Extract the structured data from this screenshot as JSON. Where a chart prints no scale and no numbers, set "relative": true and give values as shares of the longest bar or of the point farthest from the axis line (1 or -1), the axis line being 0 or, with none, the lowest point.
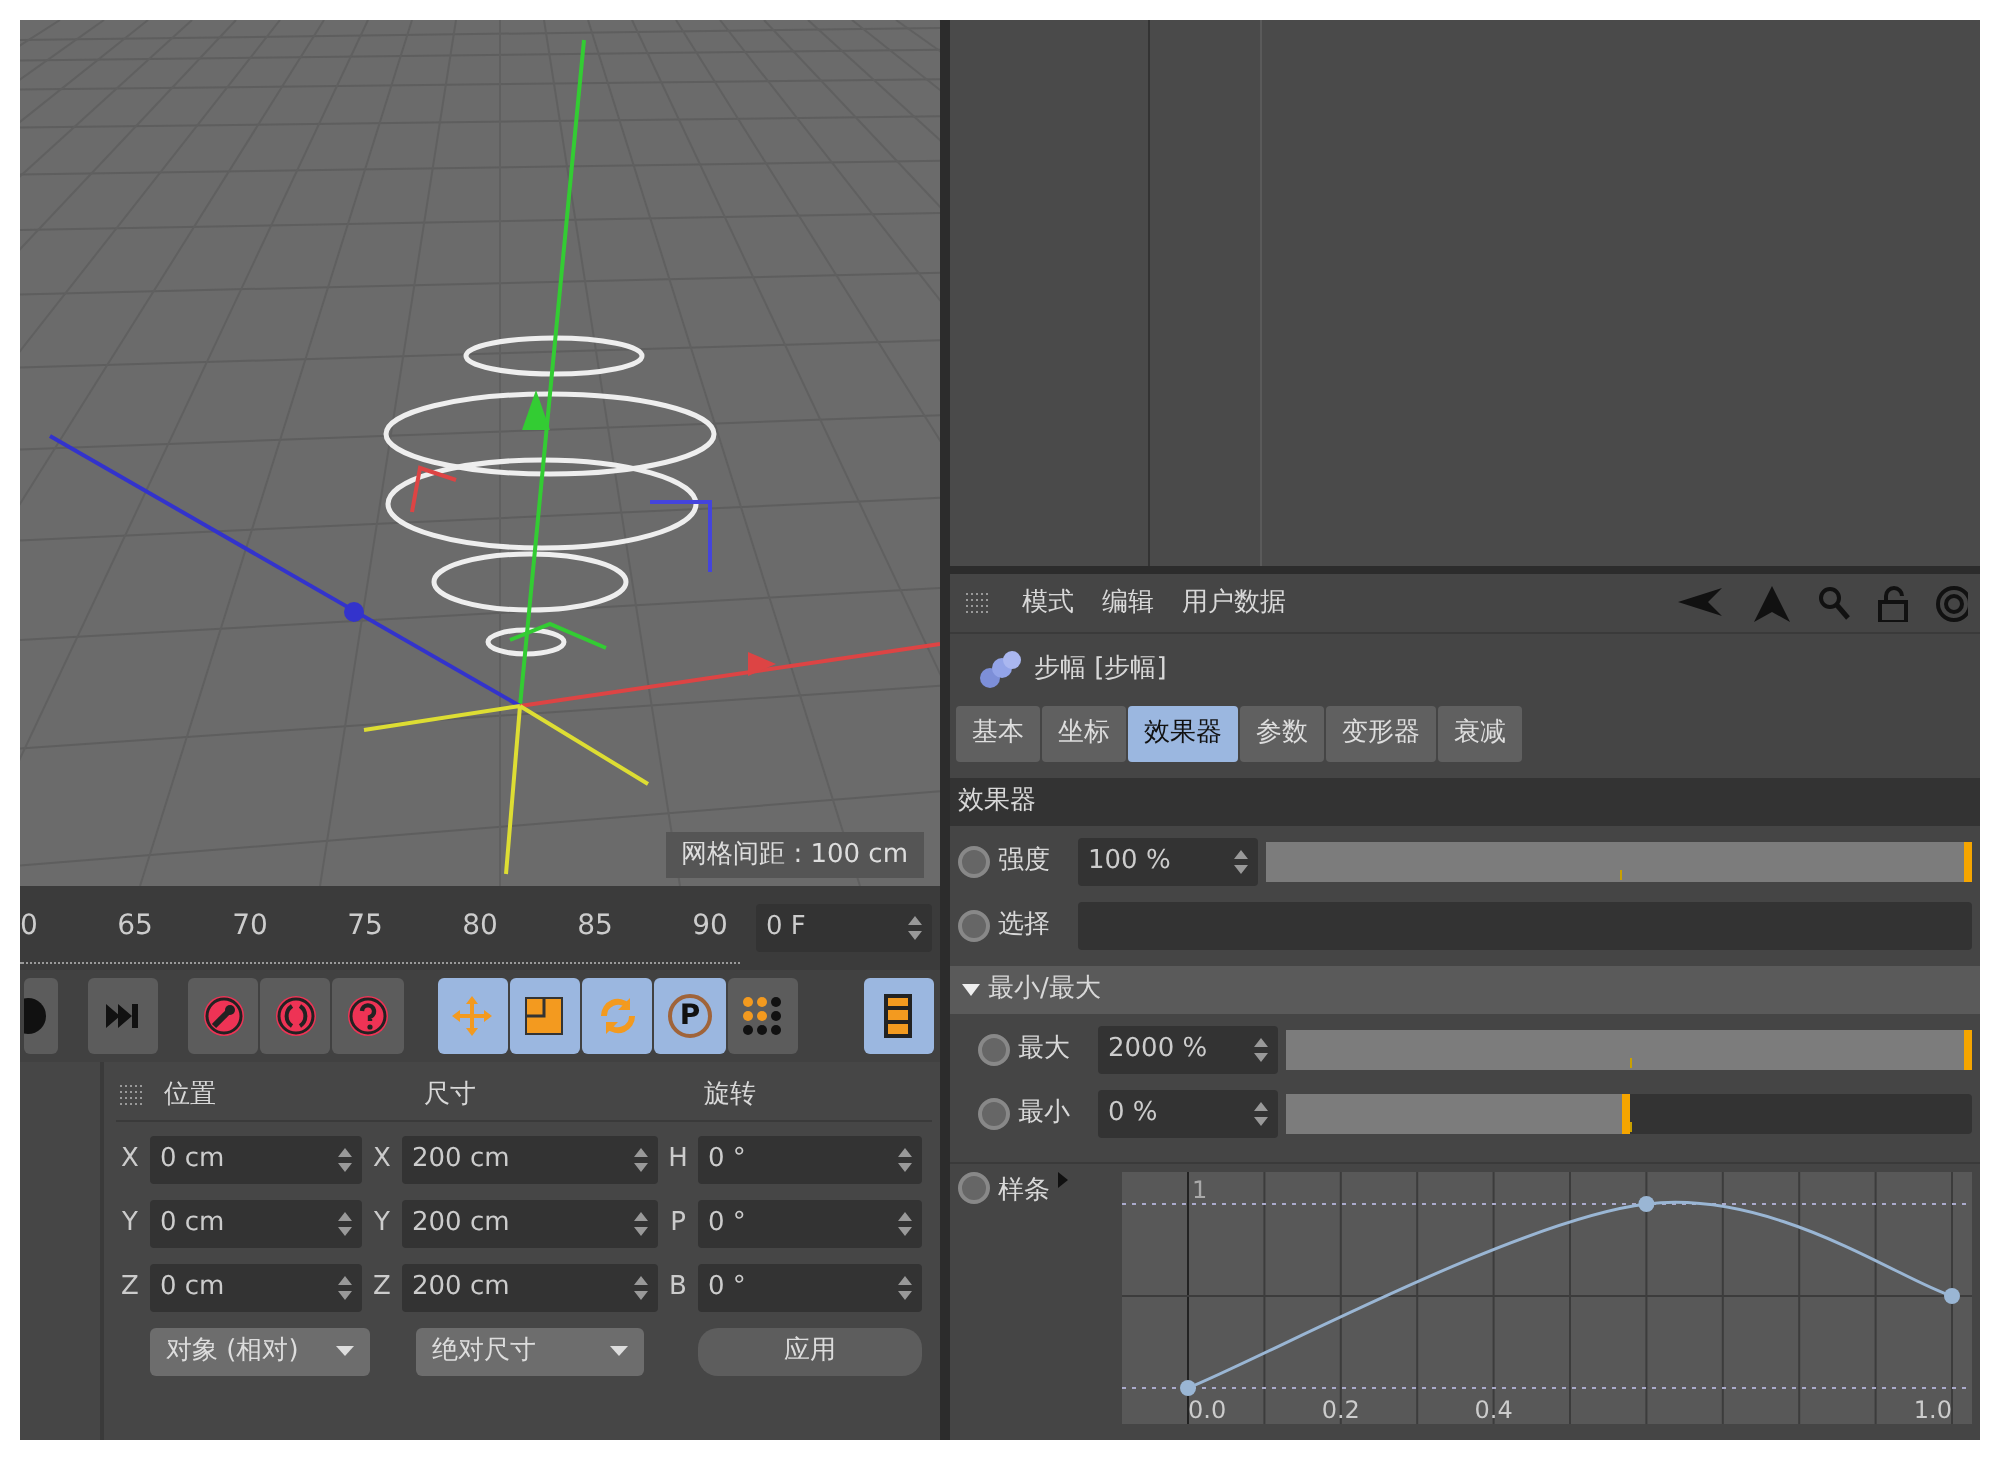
{
  "viewport": {
    "grid_spacing": "网格间距 : 100 cm"
  },
  "timeline": {
    "ticks": [
      "0",
      "65",
      "70",
      "75",
      "80",
      "85",
      "90"
    ],
    "frame_field": "0 F"
  },
  "toolbar": [
    {
      "kind": "play",
      "selected": false
    },
    {
      "kind": "end",
      "selected": false
    },
    {
      "kind": "record",
      "selected": false
    },
    {
      "kind": "autokey",
      "selected": false
    },
    {
      "kind": "help",
      "selected": false
    },
    {
      "kind": "move",
      "selected": true
    },
    {
      "kind": "scale",
      "selected": true
    },
    {
      "kind": "rotate",
      "selected": true
    },
    {
      "kind": "point",
      "label": "P",
      "selected": true
    },
    {
      "kind": "dots",
      "selected": false
    },
    {
      "kind": "film",
      "selected": true
    }
  ],
  "coordinates": {
    "headers": [
      "位置",
      "尺寸",
      "旋转"
    ],
    "rows": [
      {
        "pos_label": "X",
        "pos": "0 cm",
        "size_label": "X",
        "size": "200 cm",
        "rot_label": "H",
        "rot": "0 °"
      },
      {
        "pos_label": "Y",
        "pos": "0 cm",
        "size_label": "Y",
        "size": "200 cm",
        "rot_label": "P",
        "rot": "0 °"
      },
      {
        "pos_label": "Z",
        "pos": "0 cm",
        "size_label": "Z",
        "size": "200 cm",
        "rot_label": "B",
        "rot": "0 °"
      }
    ],
    "dropdowns": [
      "对象 (相对)",
      "绝对尺寸"
    ],
    "apply": "应用"
  },
  "attributes": {
    "menu": [
      "模式",
      "编辑",
      "用户数据"
    ],
    "object": "步幅 [步幅]",
    "tabs": [
      {
        "label": "基本",
        "selected": false
      },
      {
        "label": "坐标",
        "selected": false
      },
      {
        "label": "效果器",
        "selected": true
      },
      {
        "label": "参数",
        "selected": false
      },
      {
        "label": "变形器",
        "selected": false
      },
      {
        "label": "衰减",
        "selected": false
      }
    ],
    "section": "效果器",
    "fields": [
      {
        "kind": "slider",
        "label": "强度",
        "value": "100 %",
        "level": 1.0
      },
      {
        "kind": "link",
        "label": "选择"
      }
    ],
    "group": {
      "title": "最小/最大",
      "expanded": true,
      "fields": [
        {
          "kind": "slider",
          "label": "最大",
          "value": "2000 %",
          "level": 1.0
        },
        {
          "kind": "slider",
          "label": "最小",
          "value": "0 %",
          "level": 0.5
        }
      ]
    },
    "spline": {
      "label": "样条",
      "chart_data": {
        "type": "line",
        "x": [
          0,
          0.6,
          1.0
        ],
        "series": [
          {
            "color": "#9ab6d4",
            "marker": "circle",
            "values": [
              0,
              1,
              0.5
            ]
          }
        ],
        "xlim": [
          0,
          1
        ],
        "relative": true,
        "xticks": [
          {
            "value": 0,
            "label": "0.0"
          },
          {
            "value": 0.2,
            "label": "0.2"
          },
          {
            "value": 0.4,
            "label": "0.4"
          },
          {
            "value": 1,
            "label": "1.0"
          }
        ],
        "annotations": [
          {
            "text": "1"
          }
        ]
      }
    }
  }
}
